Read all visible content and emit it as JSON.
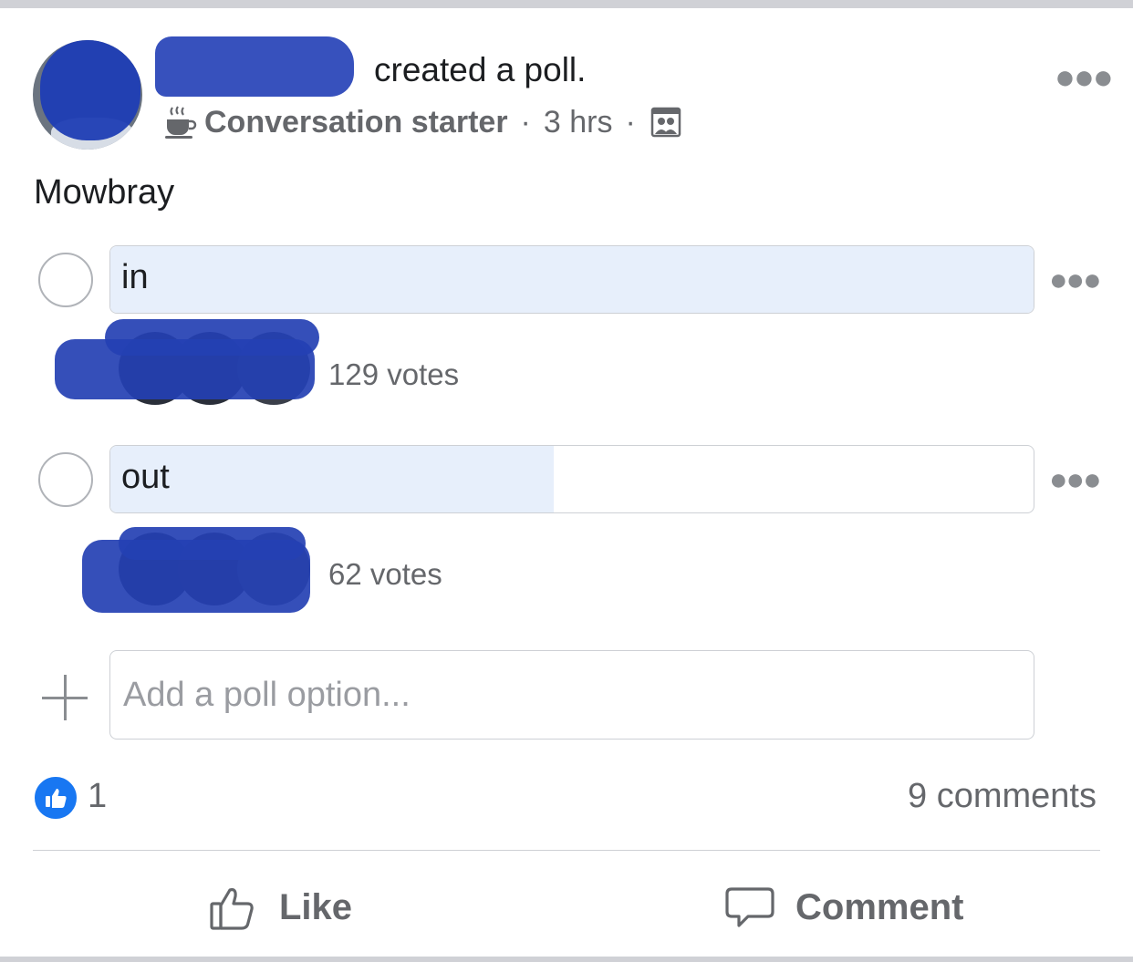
{
  "post": {
    "headline": "created a poll.",
    "badge": "Conversation starter",
    "separator": "·",
    "time": "3 hrs",
    "more_icon": "more-horizontal-icon",
    "audience_icon": "group-icon",
    "badge_icon": "coffee-cup-icon",
    "text": "Mowbray"
  },
  "poll": {
    "options": [
      {
        "label": "in",
        "votes_text": "129 votes",
        "votes": 129,
        "fill_fraction": 1.0
      },
      {
        "label": "out",
        "votes_text": "62 votes",
        "votes": 62,
        "fill_fraction": 0.48
      }
    ],
    "add_option_placeholder": "Add a poll option..."
  },
  "stats": {
    "like_count": "1",
    "comments": "9 comments"
  },
  "actions": {
    "like": "Like",
    "comment": "Comment"
  },
  "colors": {
    "accent": "#1877f2",
    "poll_fill": "#e7effb",
    "redaction": "#2440b3",
    "secondary_text": "#65676b"
  }
}
